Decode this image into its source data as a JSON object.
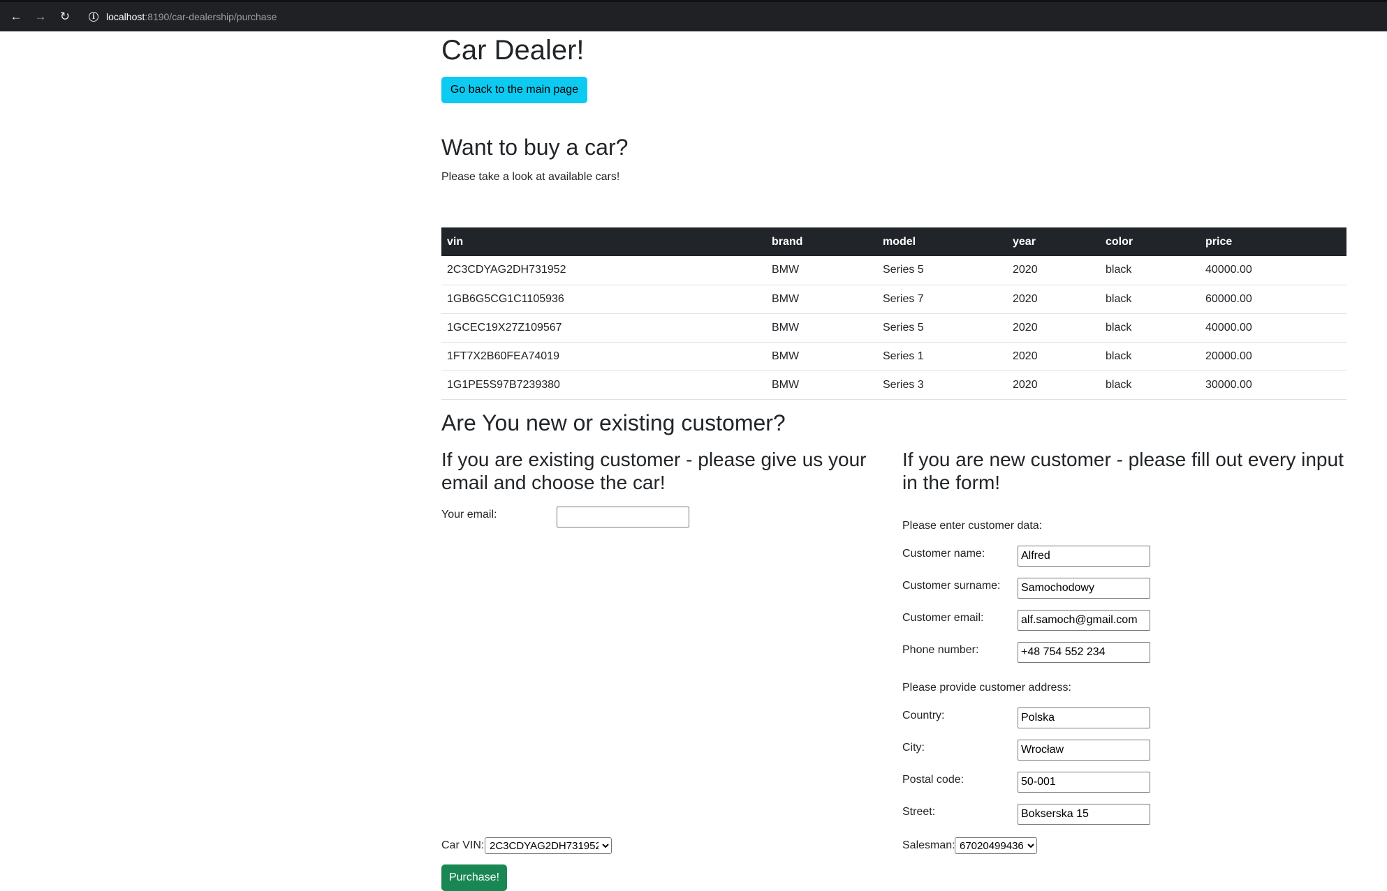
{
  "browser": {
    "url_host": "localhost",
    "url_rest": ":8190/car-dealership/purchase"
  },
  "header": {
    "title": "Car Dealer!",
    "back_button": "Go back to the main page"
  },
  "cars_section": {
    "heading": "Want to buy a car?",
    "subtitle": "Please take a look at available cars!",
    "columns": [
      "vin",
      "brand",
      "model",
      "year",
      "color",
      "price"
    ],
    "rows": [
      [
        "2C3CDYAG2DH731952",
        "BMW",
        "Series 5",
        "2020",
        "black",
        "40000.00"
      ],
      [
        "1GB6G5CG1C1105936",
        "BMW",
        "Series 7",
        "2020",
        "black",
        "60000.00"
      ],
      [
        "1GCEC19X27Z109567",
        "BMW",
        "Series 5",
        "2020",
        "black",
        "40000.00"
      ],
      [
        "1FT7X2B60FEA74019",
        "BMW",
        "Series 1",
        "2020",
        "black",
        "20000.00"
      ],
      [
        "1G1PE5S97B7239380",
        "BMW",
        "Series 3",
        "2020",
        "black",
        "30000.00"
      ]
    ]
  },
  "customer_section": {
    "heading": "Are You new or existing customer?",
    "existing": {
      "heading": "If you are existing customer - please give us your email and choose the car!",
      "email_label": "Your email:",
      "email_value": ""
    },
    "new": {
      "heading": "If you are new customer - please fill out every input in the form!",
      "data_caption": "Please enter customer data:",
      "name_label": "Customer name:",
      "name_value": "Alfred",
      "surname_label": "Customer surname:",
      "surname_value": "Samochodowy",
      "email_label": "Customer email:",
      "email_value": "alf.samoch@gmail.com",
      "phone_label": "Phone number:",
      "phone_value": "+48 754 552 234",
      "address_caption": "Please provide customer address:",
      "country_label": "Country:",
      "country_value": "Polska",
      "city_label": "City:",
      "city_value": "Wrocław",
      "postal_label": "Postal code:",
      "postal_value": "50-001",
      "street_label": "Street:",
      "street_value": "Bokserska 15"
    },
    "car_vin_label": "Car VIN:",
    "car_vin_selected": "2C3CDYAG2DH731952",
    "salesman_label": "Salesman:",
    "salesman_selected": "67020499436",
    "purchase_button": "Purchase!"
  }
}
